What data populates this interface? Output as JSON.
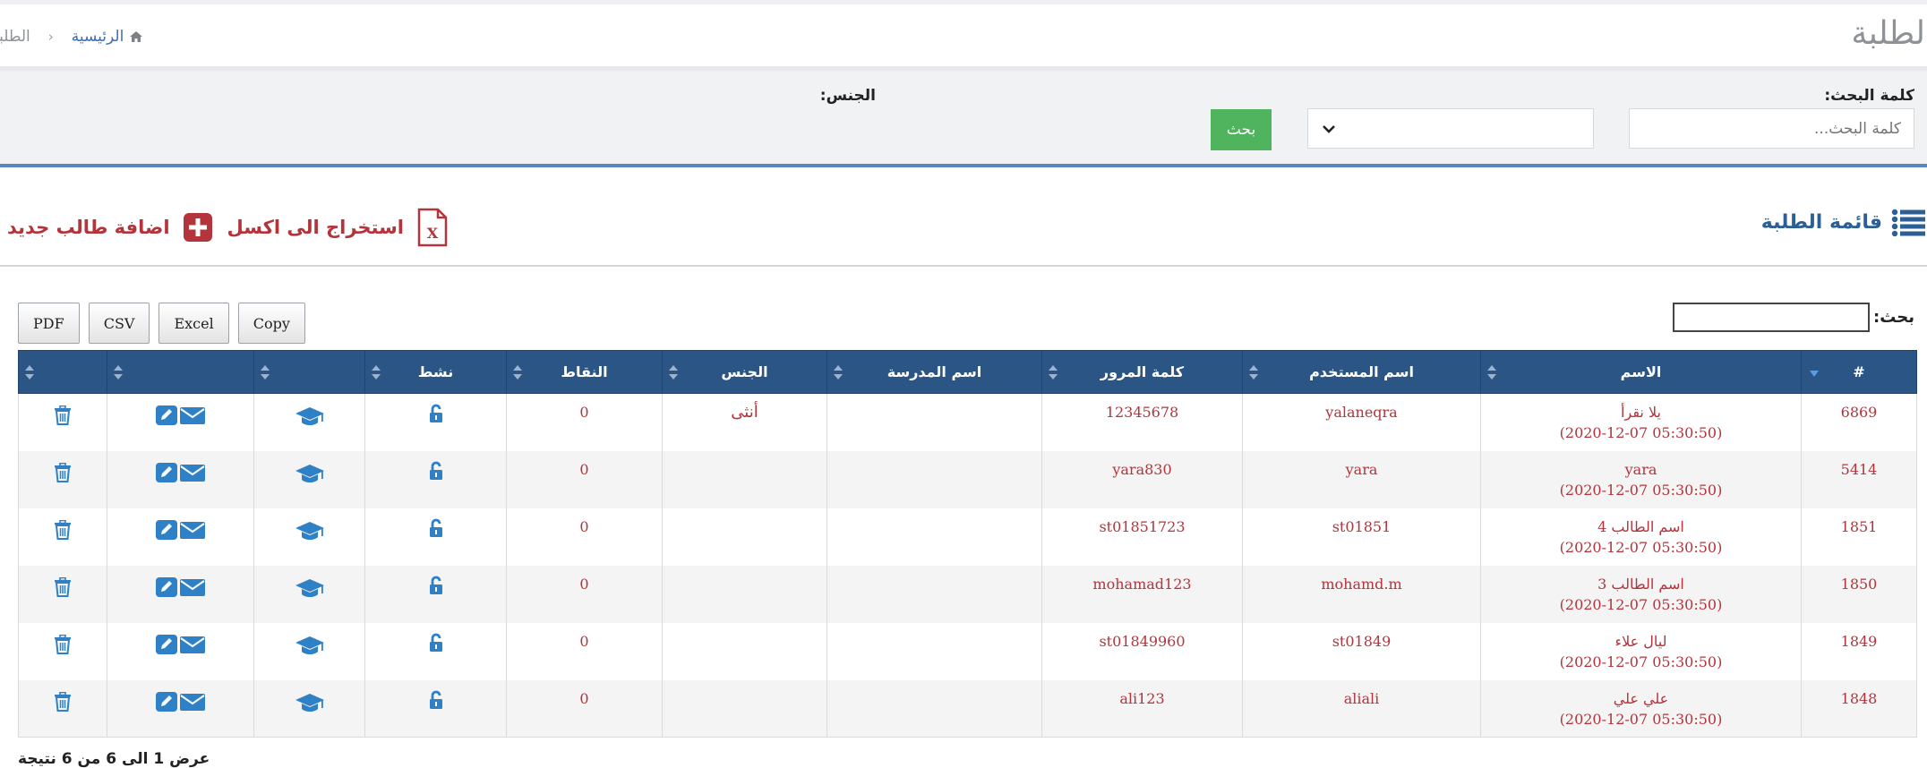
{
  "header": {
    "page_title": "الطلبة",
    "breadcrumb": {
      "home": "الرئيسية",
      "current": "الطلبة"
    }
  },
  "search": {
    "keyword_label": "كلمة البحث:",
    "keyword_placeholder": "كلمة البحث...",
    "gender_label": "الجنس:",
    "gender_value": "",
    "button": "بحث"
  },
  "list": {
    "title": "قائمة الطلبة",
    "export_excel": "استخراج الى اكسل",
    "add_student": "اضافة طالب جديد"
  },
  "datatable": {
    "buttons": [
      "Copy",
      "Excel",
      "CSV",
      "PDF"
    ],
    "filter_label": "بحث:",
    "filter_value": "",
    "columns": [
      "#",
      "الاسم",
      "اسم المستخدم",
      "كلمة المرور",
      "اسم المدرسة",
      "الجنس",
      "النقاط",
      "نشط",
      "",
      "",
      ""
    ],
    "rows": [
      {
        "id": "6869",
        "name": "يلا نقرأ",
        "date": "(05:30:50 2020-12-07)",
        "username": "yalaneqra",
        "password": "12345678",
        "school": "",
        "gender": "أنثى",
        "points": "0"
      },
      {
        "id": "5414",
        "name": "yara",
        "date": "(05:30:50 2020-12-07)",
        "username": "yara",
        "password": "yara830",
        "school": "",
        "gender": "",
        "points": "0"
      },
      {
        "id": "1851",
        "name": "اسم الطالب 4",
        "date": "(05:30:50 2020-12-07)",
        "username": "st01851",
        "password": "st01851723",
        "school": "",
        "gender": "",
        "points": "0"
      },
      {
        "id": "1850",
        "name": "اسم الطالب 3",
        "date": "(05:30:50 2020-12-07)",
        "username": "mohamd.m",
        "password": "mohamad123",
        "school": "",
        "gender": "",
        "points": "0"
      },
      {
        "id": "1849",
        "name": "ليال علاء",
        "date": "(05:30:50 2020-12-07)",
        "username": "st01849",
        "password": "st01849960",
        "school": "",
        "gender": "",
        "points": "0"
      },
      {
        "id": "1848",
        "name": "علي علي",
        "date": "(05:30:50 2020-12-07)",
        "username": "aliali",
        "password": "ali123",
        "school": "",
        "gender": "",
        "points": "0"
      }
    ],
    "info": "عرض 1 الى 6 من 6 نتيجة"
  },
  "icons": {
    "home": "home-icon",
    "list": "list-icon",
    "excel": "excel-file-icon",
    "add": "plus-icon",
    "active": "unlock-icon",
    "school": "graduation-cap-icon",
    "edit": "pencil-icon",
    "mail": "envelope-icon",
    "delete": "trash-icon"
  },
  "colors": {
    "primary": "#2b5585",
    "title_blue": "#2b5f95",
    "accent_red": "#b3343b",
    "icon_blue": "#2e80c7",
    "search_green": "#4fb45d"
  }
}
